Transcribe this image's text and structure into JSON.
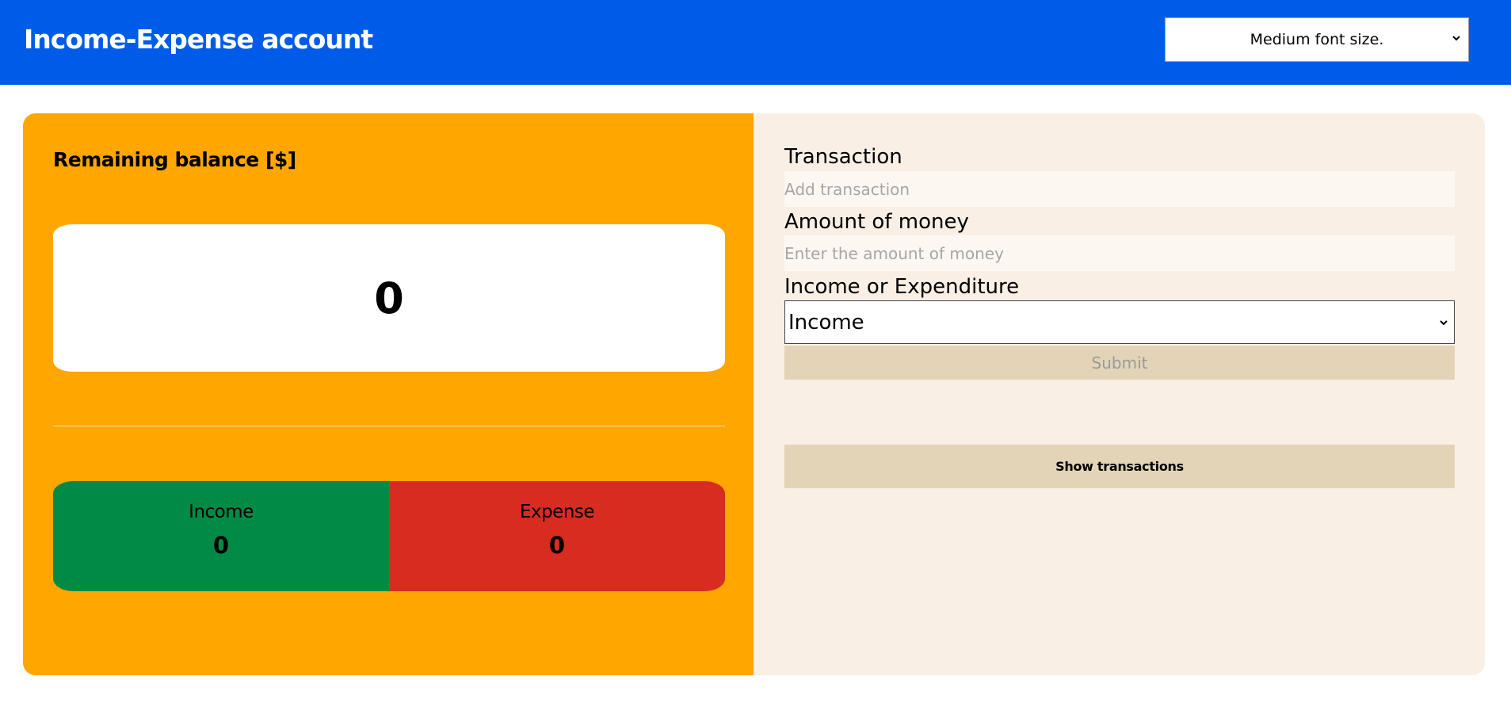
{
  "header": {
    "title": "Income-Expense account",
    "font_size_select": {
      "value": "Medium font size.",
      "icon": "chevron-down-icon"
    }
  },
  "balance": {
    "heading": "Remaining balance [$]",
    "value": "0"
  },
  "summary": {
    "income_label": "Income",
    "income_value": "0",
    "expense_label": "Expense",
    "expense_value": "0"
  },
  "form": {
    "transaction_label": "Transaction",
    "transaction_placeholder": "Add transaction",
    "amount_label": "Amount of money",
    "amount_placeholder": "Enter the amount of money",
    "type_label": "Income or Expenditure",
    "type_value": "Income",
    "submit_label": "Submit",
    "show_transactions_label": "Show transactions"
  },
  "colors": {
    "header_bg": "#005ce8",
    "left_panel_bg": "#ffa600",
    "right_panel_bg": "#f9efe5",
    "income_bg": "#008a45",
    "expense_bg": "#d82c20",
    "button_bg": "#e3d4b7"
  }
}
